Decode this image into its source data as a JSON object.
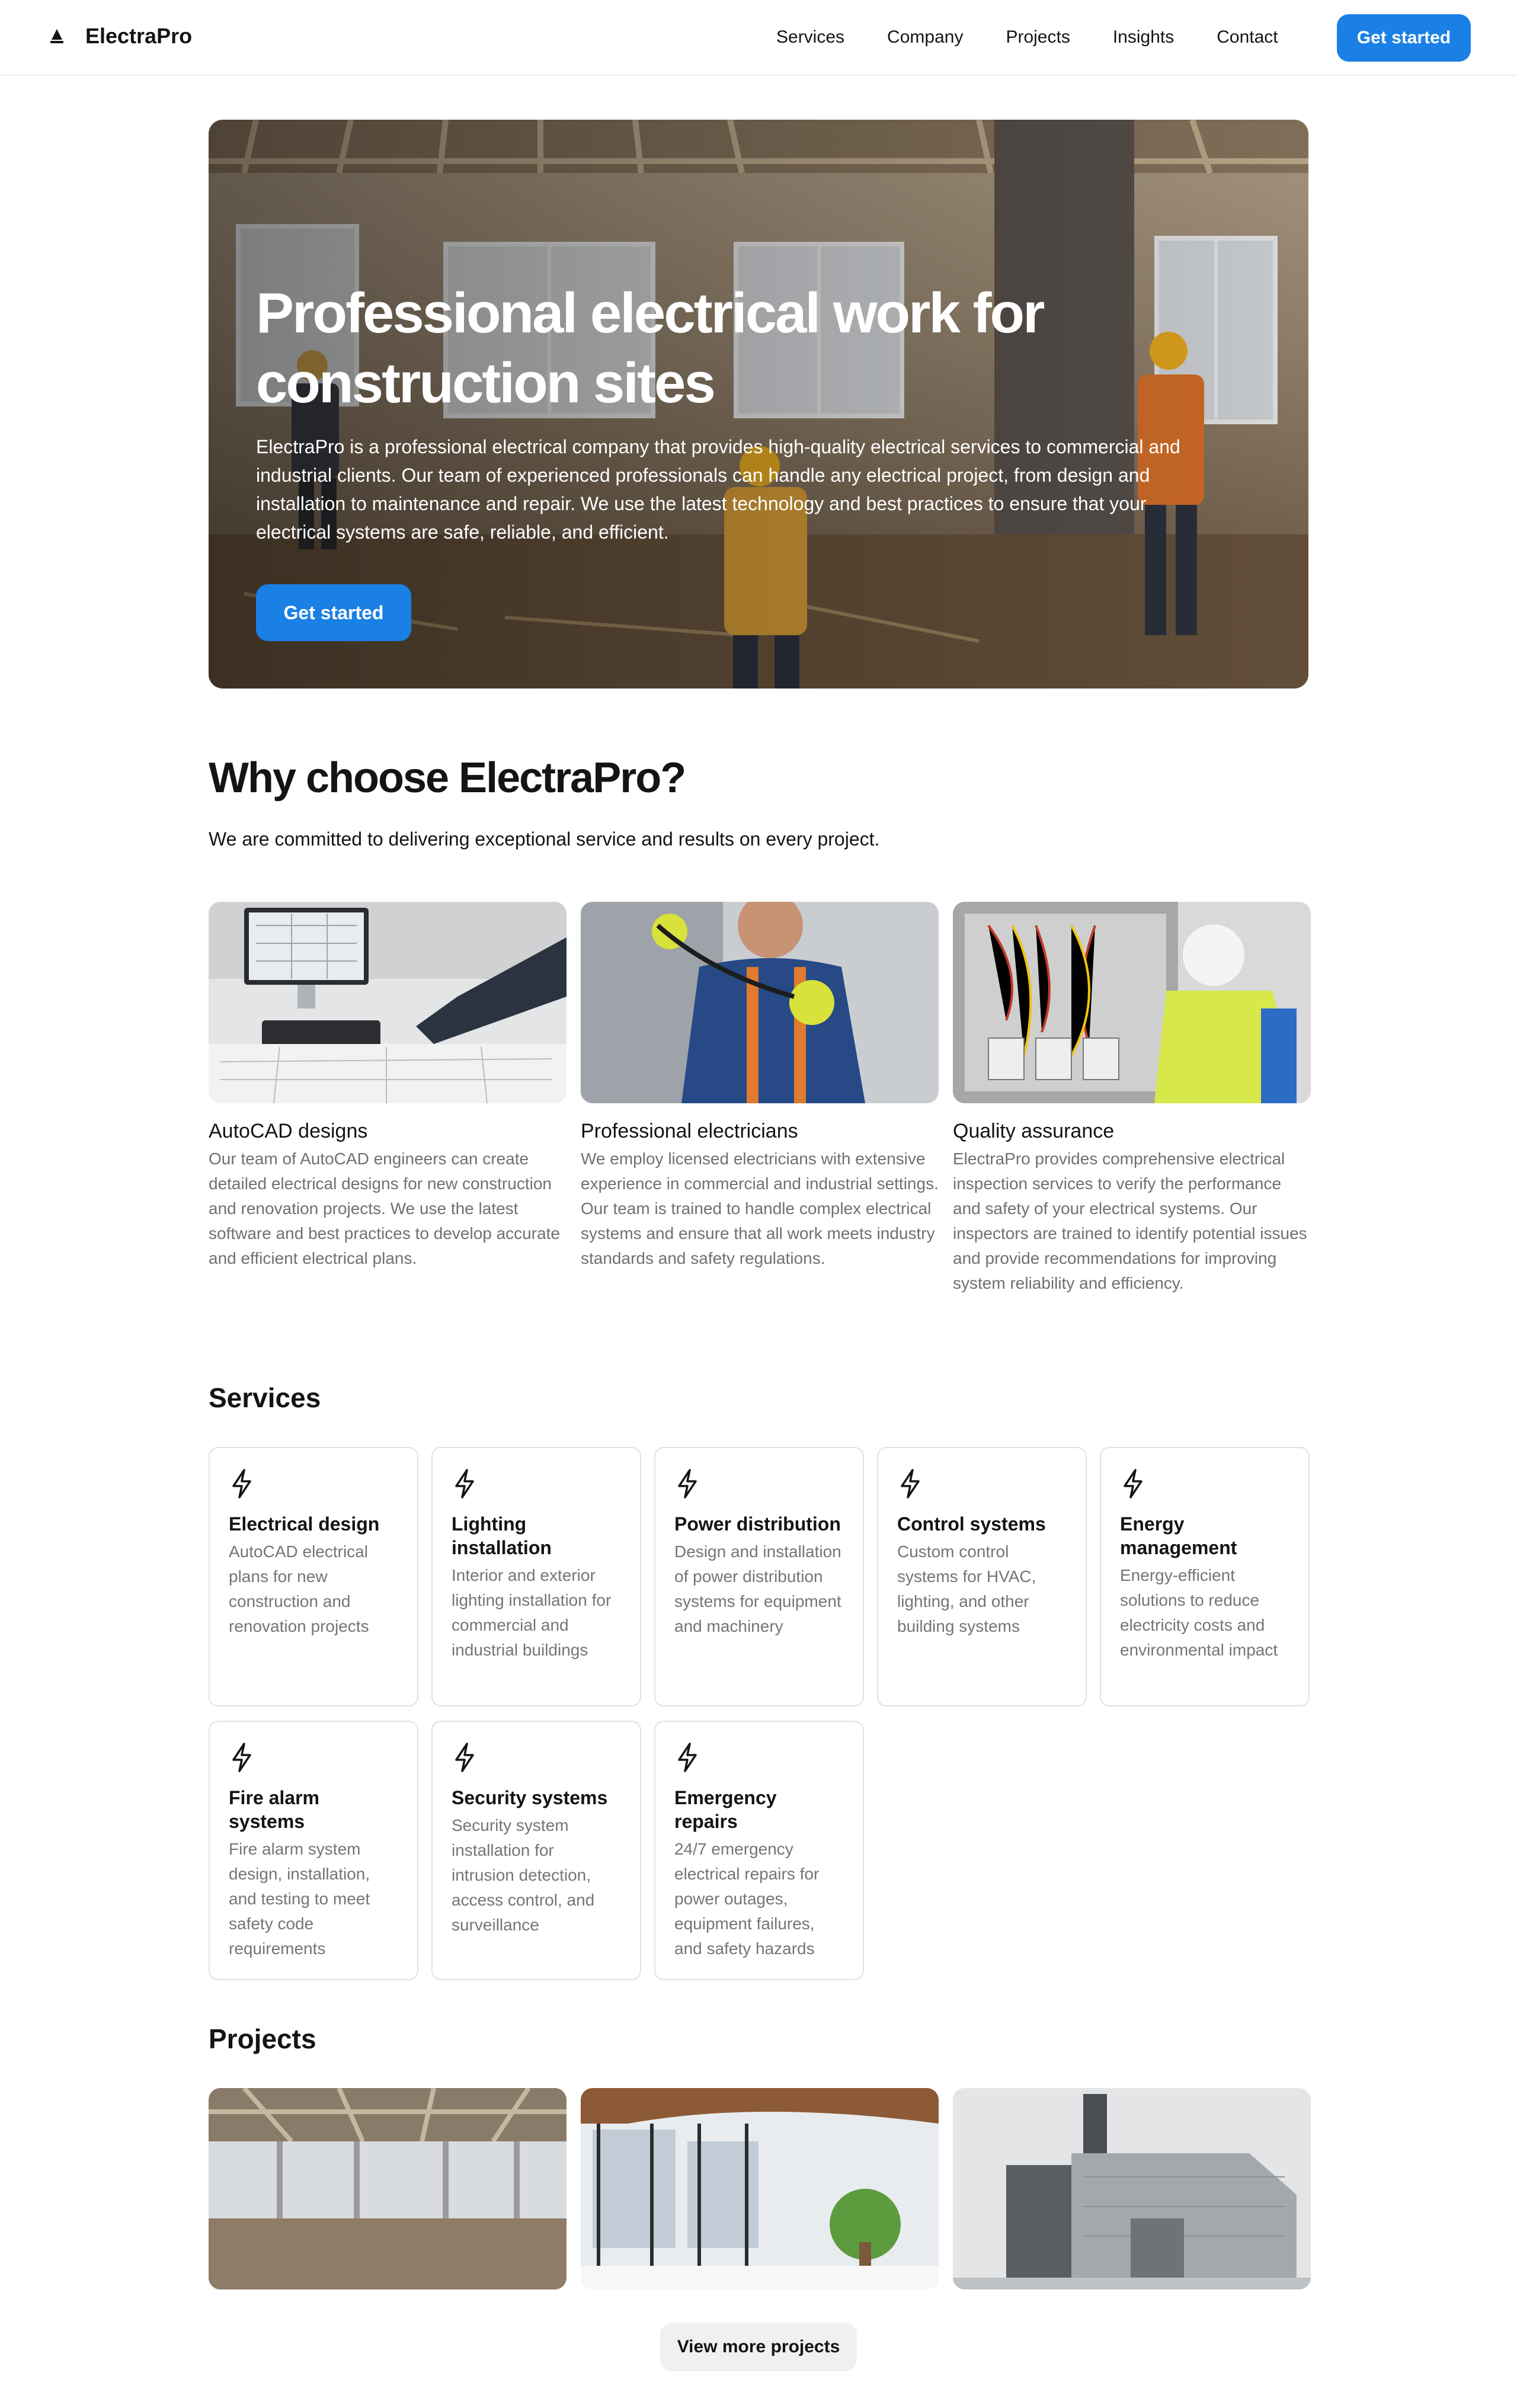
{
  "nav": {
    "brand": "ElectraPro",
    "links": [
      "Services",
      "Company",
      "Projects",
      "Insights",
      "Contact"
    ],
    "cta": "Get started"
  },
  "hero": {
    "title": "Professional electrical work for construction sites",
    "text": "ElectraPro is a professional electrical company that provides high-quality electrical services to commercial and industrial clients. Our team of experienced professionals can handle any electrical project, from design and installation to maintenance and repair. We use the latest technology and best practices to ensure that your electrical systems are safe, reliable, and efficient.",
    "cta": "Get started"
  },
  "why": {
    "title": "Why choose ElectraPro?",
    "subtitle": "We are committed to delivering exceptional service and results on every project.",
    "features": [
      {
        "title": "AutoCAD designs",
        "desc": "Our team of AutoCAD engineers can create detailed electrical designs for new construction and renovation projects. We use the latest software and best practices to develop accurate and efficient electrical plans."
      },
      {
        "title": "Professional electricians",
        "desc": "We employ licensed electricians with extensive experience in commercial and industrial settings. Our team is trained to handle complex electrical systems and ensure that all work meets industry standards and safety regulations."
      },
      {
        "title": "Quality assurance",
        "desc": "ElectraPro provides comprehensive electrical inspection services to verify the performance and safety of your electrical systems. Our inspectors are trained to identify potential issues and provide recommendations for improving system reliability and efficiency."
      }
    ]
  },
  "services": {
    "title": "Services",
    "icon": "lightning-bolt-icon",
    "items": [
      {
        "title": "Electrical design",
        "desc": "AutoCAD electrical plans for new construction and renovation projects"
      },
      {
        "title": "Lighting installation",
        "desc": "Interior and exterior lighting installation for commercial and industrial buildings"
      },
      {
        "title": "Power distribution",
        "desc": "Design and installation of power distribution systems for equipment and machinery"
      },
      {
        "title": "Control systems",
        "desc": "Custom control systems for HVAC, lighting, and other building systems"
      },
      {
        "title": "Energy management",
        "desc": "Energy-efficient solutions to reduce electricity costs and environmental impact"
      },
      {
        "title": "Fire alarm systems",
        "desc": "Fire alarm system design, installation, and testing to meet safety code requirements"
      },
      {
        "title": "Security systems",
        "desc": "Security system installation for intrusion detection, access control, and surveillance"
      },
      {
        "title": "Emergency repairs",
        "desc": "24/7 emergency electrical repairs for power outages, equipment failures, and safety hazards"
      }
    ]
  },
  "projects": {
    "title": "Projects",
    "more": "View more projects"
  },
  "colors": {
    "accent": "#1a80e5",
    "text": "#141414",
    "muted": "#757575",
    "border": "#e2e2e2",
    "button_secondary": "#f0f0f0"
  }
}
